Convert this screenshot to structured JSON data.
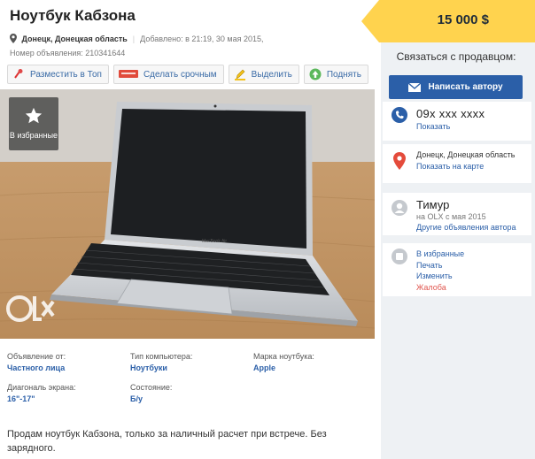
{
  "listing": {
    "title": "Ноутбук Кабзона",
    "location": "Донецк, Донецкая область",
    "added": "Добавлено: в 21:19, 30 мая 2015,",
    "ad_number": "Номер объявления: 210341644",
    "price": "15 000 $"
  },
  "actions": [
    {
      "label": "Разместить в Топ",
      "icon": "pin-icon"
    },
    {
      "label": "Сделать срочным",
      "icon": "urgent-icon"
    },
    {
      "label": "Выделить",
      "icon": "highlight-icon"
    },
    {
      "label": "Поднять",
      "icon": "raise-icon"
    }
  ],
  "photo": {
    "favorite_label": "В избранные",
    "watermark": "OLX"
  },
  "specs": [
    {
      "label": "Объявление от:",
      "value": "Частного лица"
    },
    {
      "label": "Тип компьютера:",
      "value": "Ноутбуки"
    },
    {
      "label": "Марка ноутбука:",
      "value": "Apple"
    },
    {
      "label": "Диагональ экрана:",
      "value": "16\"-17\""
    },
    {
      "label": "Состояние:",
      "value": "Б/у"
    }
  ],
  "description": "Продам ноутбук Кабзона, только за наличный расчет при встрече. Без зарядного.",
  "sidebar": {
    "contact_title": "Связаться с продавцом:",
    "write_button": "Написать автору",
    "phone": "09x xxx xxxx",
    "show_phone": "Показать",
    "location": "Донецк, Донецкая область",
    "show_map": "Показать на карте",
    "seller_name": "Тимур",
    "seller_since": "на OLX с мая 2015",
    "other_ads": "Другие объявления автора",
    "links": {
      "favorite": "В избранные",
      "print": "Печать",
      "edit": "Изменить",
      "complain": "Жалоба"
    }
  },
  "colors": {
    "accent": "#2b5fa8",
    "price_bg": "#ffd34e",
    "sidebar_bg": "#eef1f4",
    "danger": "#e0564f"
  }
}
